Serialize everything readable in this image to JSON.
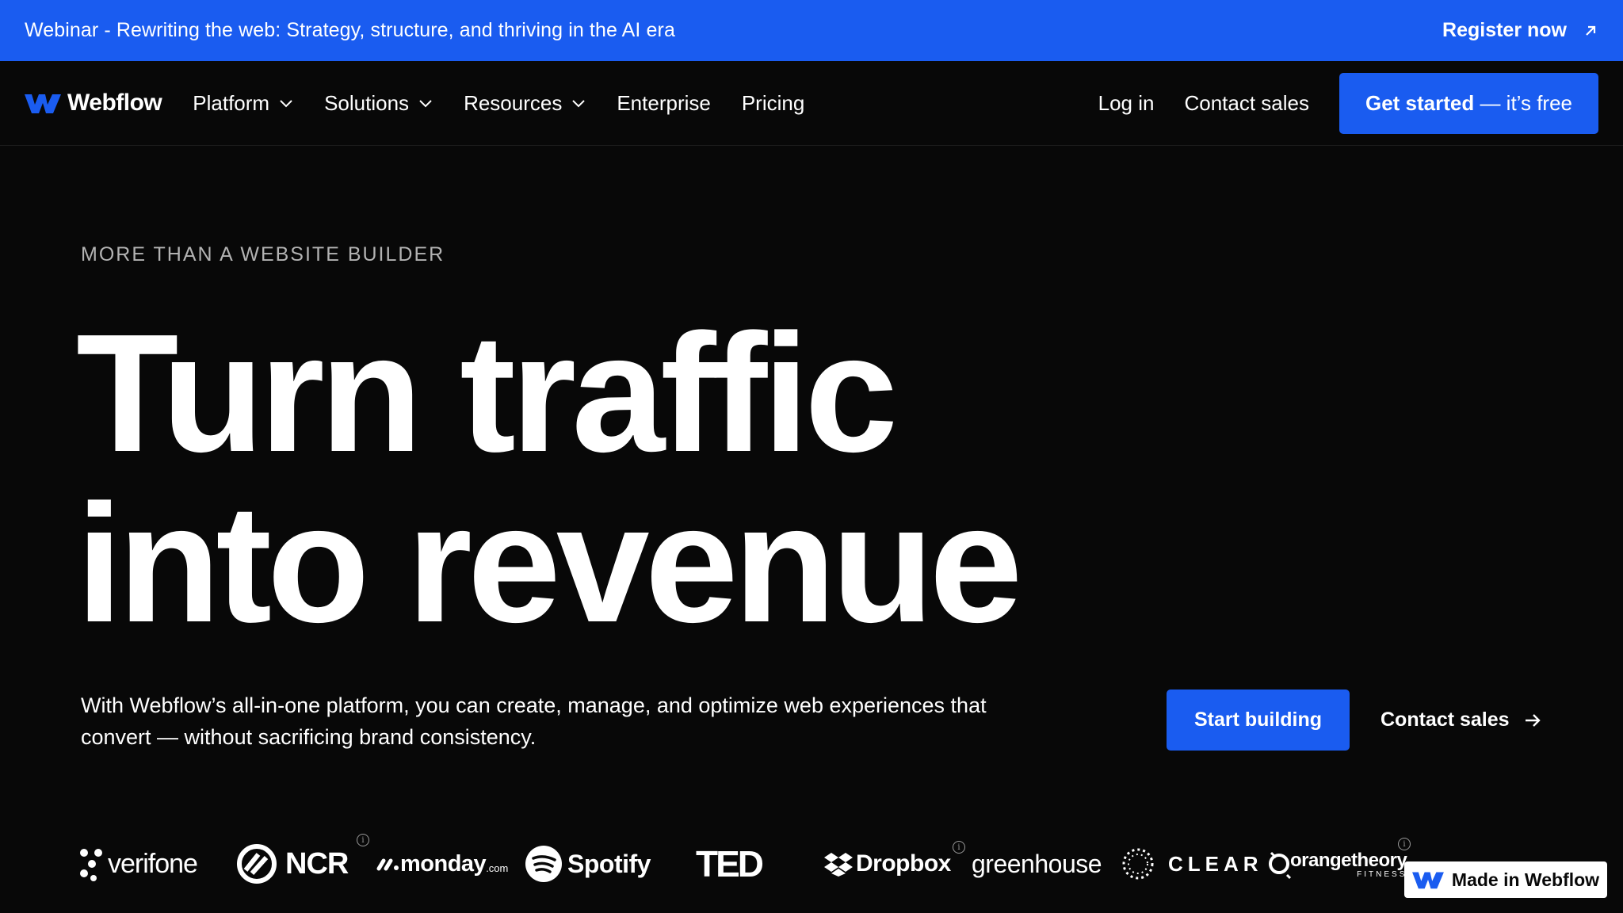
{
  "banner": {
    "text": "Webinar - Rewriting the web: Strategy, structure, and thriving in the AI era",
    "link_label": "Register now"
  },
  "nav": {
    "logo_text": "Webflow",
    "menu": [
      {
        "label": "Platform",
        "has_dropdown": true
      },
      {
        "label": "Solutions",
        "has_dropdown": true
      },
      {
        "label": "Resources",
        "has_dropdown": true
      },
      {
        "label": "Enterprise",
        "has_dropdown": false
      },
      {
        "label": "Pricing",
        "has_dropdown": false
      }
    ],
    "login_label": "Log in",
    "contact_label": "Contact sales",
    "cta_bold": "Get started",
    "cta_rest": " — it’s free"
  },
  "hero": {
    "eyebrow": "MORE THAN A WEBSITE BUILDER",
    "headline_line1": "Turn traffic",
    "headline_line2": "into revenue",
    "subtext": "With Webflow’s all-in-one platform, you can create, manage, and optimize web experiences that convert — without sacrificing brand consistency.",
    "primary_button": "Start building",
    "secondary_button": "Contact sales"
  },
  "customer_logos": [
    {
      "name": "verifone",
      "icon": "verifone-dots-icon"
    },
    {
      "name": "NCR",
      "icon": "ncr-ring-icon"
    },
    {
      "name": "monday",
      "suffix": ".com",
      "icon": "monday-marks-icon"
    },
    {
      "name": "Spotify",
      "icon": "spotify-icon"
    },
    {
      "name": "TED"
    },
    {
      "name": "Dropbox",
      "icon": "dropbox-icon"
    },
    {
      "name": "greenhouse"
    },
    {
      "name": "CLEAR",
      "icon": "clear-circle-icon"
    },
    {
      "name": "orangetheory",
      "sub": "FITNESS",
      "icon": "orangetheory-icon"
    }
  ],
  "badge": {
    "label": "Made in Webflow"
  },
  "colors": {
    "accent": "#1a5cf0",
    "background": "#080808",
    "text": "#ffffff",
    "muted": "#b3b3b3"
  }
}
